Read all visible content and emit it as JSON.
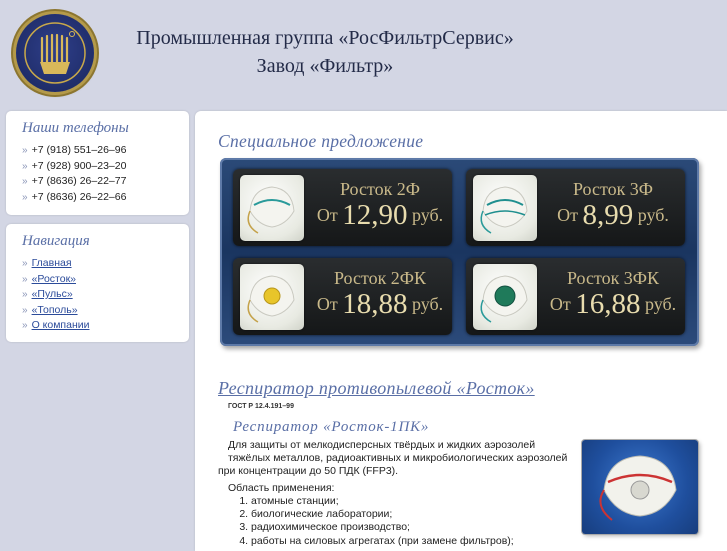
{
  "header": {
    "line1": "Промышленная группа «РосФильтрСервис»",
    "line2": "Завод «Фильтр»"
  },
  "phones": {
    "title": "Наши телефоны",
    "items": [
      "+7 (918) 551–26–96",
      "+7 (928) 900–23–20",
      "+7 (8636) 26–22–77",
      "+7 (8636) 26–22–66"
    ]
  },
  "nav": {
    "title": "Навигация",
    "items": [
      "Главная",
      "«Росток»",
      "«Пульс»",
      "«Тополь»",
      "О компании"
    ]
  },
  "bullet": "»",
  "special": {
    "title": "Специальное предложение",
    "cards": [
      {
        "name": "Росток 2Ф",
        "prefix": "От",
        "price": "12,90",
        "currency": "руб."
      },
      {
        "name": "Росток 3Ф",
        "prefix": "От",
        "price": "8,99",
        "currency": "руб."
      },
      {
        "name": "Росток 2ФК",
        "prefix": "От",
        "price": "18,88",
        "currency": "руб."
      },
      {
        "name": "Росток 3ФК",
        "prefix": "От",
        "price": "16,88",
        "currency": "руб."
      }
    ]
  },
  "product": {
    "title": "Респиратор противопылевой «Росток»",
    "gost": "ГОСТ Р 12.4.191–99",
    "subtitle": "Респиратор «Росток-1ПК»",
    "desc1": "Для защиты от мелкодисперсных твёрдых и жидких аэрозолей тяжёлых металлов, радиоактивных и микробиологических аэрозолей",
    "desc2": "при концентрации до 50 ПДК (FFP3).",
    "area_label": "Область применения:",
    "applications": [
      "атомные станции;",
      "биологические лаборатории;",
      "радиохимическое производство;",
      "работы на силовых агрегатах (при замене фильтров);"
    ]
  }
}
